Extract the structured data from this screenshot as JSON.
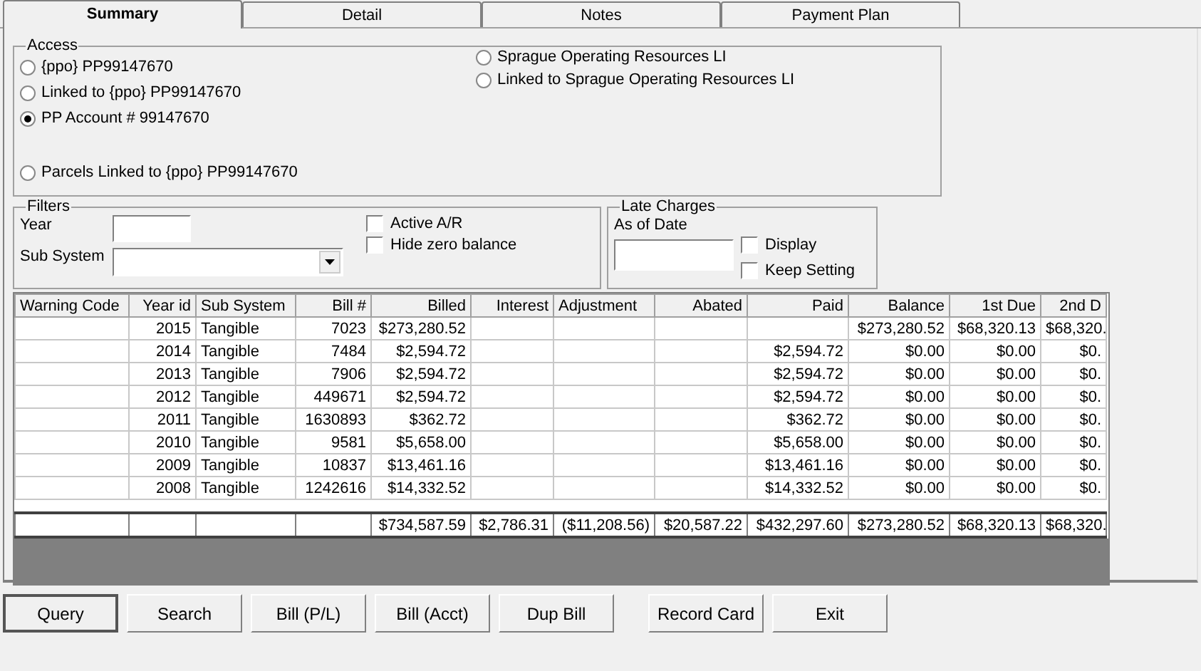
{
  "tabs": [
    {
      "label": "Summary",
      "selected": true
    },
    {
      "label": "Detail",
      "selected": false
    },
    {
      "label": "Notes",
      "selected": false
    },
    {
      "label": "Payment Plan",
      "selected": false
    }
  ],
  "access": {
    "title": "Access",
    "left_options": [
      {
        "label": "{ppo} PP99147670",
        "selected": false
      },
      {
        "label": "Linked to {ppo} PP99147670",
        "selected": false
      },
      {
        "label": "PP Account # 99147670",
        "selected": true
      },
      {
        "label": "Parcels Linked to {ppo} PP99147670",
        "selected": false
      }
    ],
    "right_options": [
      {
        "label": "Sprague Operating Resources LI",
        "selected": false
      },
      {
        "label": "Linked to Sprague Operating Resources LI",
        "selected": false
      }
    ]
  },
  "filters": {
    "title": "Filters",
    "year_label": "Year",
    "sub_system_label": "Sub System",
    "checkboxes": [
      {
        "label": "Active A/R",
        "checked": false
      },
      {
        "label": "Hide zero balance",
        "checked": false
      }
    ]
  },
  "late_charges": {
    "title": "Late Charges",
    "as_of_date_label": "As of Date",
    "checkboxes": [
      {
        "label": "Display",
        "checked": false
      },
      {
        "label": "Keep Setting",
        "checked": false
      }
    ]
  },
  "table": {
    "columns": [
      "Warning Code",
      "Year id",
      "Sub System",
      "Bill #",
      "Billed",
      "Interest",
      "Adjustment",
      "Abated",
      "Paid",
      "Balance",
      "1st Due",
      "2nd D"
    ],
    "rows": [
      {
        "year_id": "2015",
        "sub_system": "Tangible",
        "bill_no": "7023",
        "billed": "$273,280.52",
        "balance": "$273,280.52",
        "first_due": "$68,320.13",
        "second_due": "$68,320."
      },
      {
        "year_id": "2014",
        "sub_system": "Tangible",
        "bill_no": "7484",
        "billed": "$2,594.72",
        "paid": "$2,594.72",
        "balance": "$0.00",
        "first_due": "$0.00",
        "second_due": "$0."
      },
      {
        "year_id": "2013",
        "sub_system": "Tangible",
        "bill_no": "7906",
        "billed": "$2,594.72",
        "paid": "$2,594.72",
        "balance": "$0.00",
        "first_due": "$0.00",
        "second_due": "$0."
      },
      {
        "year_id": "2012",
        "sub_system": "Tangible",
        "bill_no": "449671",
        "billed": "$2,594.72",
        "paid": "$2,594.72",
        "balance": "$0.00",
        "first_due": "$0.00",
        "second_due": "$0."
      },
      {
        "year_id": "2011",
        "sub_system": "Tangible",
        "bill_no": "1630893",
        "billed": "$362.72",
        "paid": "$362.72",
        "balance": "$0.00",
        "first_due": "$0.00",
        "second_due": "$0."
      },
      {
        "year_id": "2010",
        "sub_system": "Tangible",
        "bill_no": "9581",
        "billed": "$5,658.00",
        "paid": "$5,658.00",
        "balance": "$0.00",
        "first_due": "$0.00",
        "second_due": "$0."
      },
      {
        "year_id": "2009",
        "sub_system": "Tangible",
        "bill_no": "10837",
        "billed": "$13,461.16",
        "paid": "$13,461.16",
        "balance": "$0.00",
        "first_due": "$0.00",
        "second_due": "$0."
      },
      {
        "year_id": "2008",
        "sub_system": "Tangible",
        "bill_no": "1242616",
        "billed": "$14,332.52",
        "paid": "$14,332.52",
        "balance": "$0.00",
        "first_due": "$0.00",
        "second_due": "$0."
      }
    ],
    "totals": {
      "billed": "$734,587.59",
      "interest": "$2,786.31",
      "adjustment": "($11,208.56)",
      "abated": "$20,587.22",
      "paid": "$432,297.60",
      "balance": "$273,280.52",
      "first_due": "$68,320.13",
      "second_due": "$68,320."
    }
  },
  "buttons": [
    {
      "label": "Query",
      "default": true
    },
    {
      "label": "Search",
      "default": false
    },
    {
      "label": "Bill (P/L)",
      "default": false
    },
    {
      "label": "Bill (Acct)",
      "default": false
    },
    {
      "label": "Dup Bill",
      "default": false
    },
    {
      "label": "Record Card",
      "default": false
    },
    {
      "label": "Exit",
      "default": false
    }
  ]
}
